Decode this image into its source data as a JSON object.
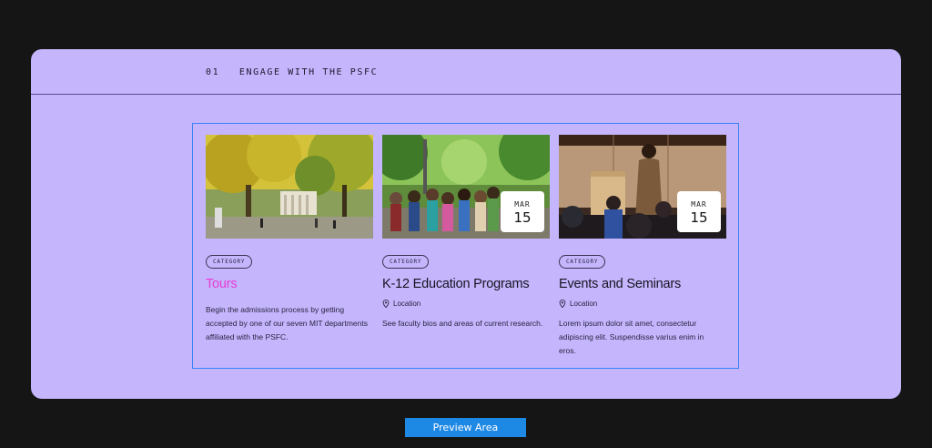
{
  "section": {
    "number": "01",
    "title": "ENGAGE WITH THE PSFC"
  },
  "cards": [
    {
      "category": "CATEGORY",
      "title": "Tours",
      "description": "Begin the admissions process by getting accepted by one of our seven MIT departments affiliated with the PSFC.",
      "image_icon": "campus-trees-photo"
    },
    {
      "category": "CATEGORY",
      "title": "K-12 Education Programs",
      "location": "Location",
      "description": "See faculty bios and areas of current research.",
      "date": {
        "month": "MAR",
        "day": "15"
      },
      "image_icon": "student-group-photo"
    },
    {
      "category": "CATEGORY",
      "title": "Events and Seminars",
      "location": "Location",
      "description": "Lorem ipsum dolor sit amet, consectetur adipiscing elit. Suspendisse varius enim in eros.",
      "date": {
        "month": "MAR",
        "day": "15"
      },
      "image_icon": "speaker-seminar-photo"
    }
  ],
  "preview_button": {
    "label": "Preview Area"
  },
  "colors": {
    "background": "#151515",
    "panel": "#c4b5fd",
    "accent_title": "#e83bd5",
    "selection": "#3b82f6",
    "button": "#1e88e5"
  }
}
